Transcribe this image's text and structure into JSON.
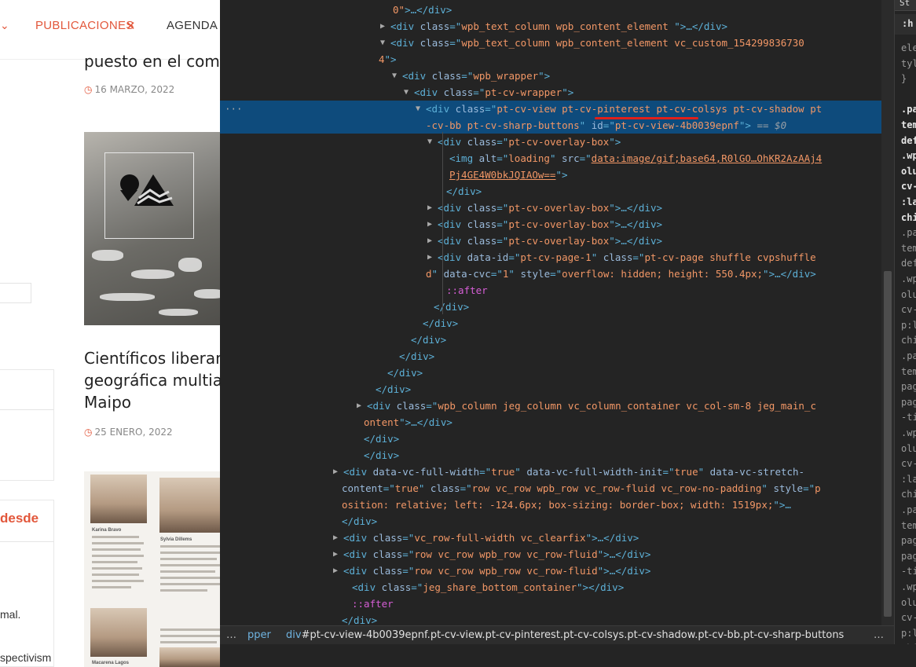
{
  "site": {
    "nav": {
      "left_chevron": "⌄",
      "publicaciones": "PUBLICACIONES",
      "publicaciones_close": "✕",
      "agenda": "AGENDA",
      "agenda_chevron": "⌄"
    },
    "article1": {
      "title": "puesto en el comit",
      "date": "16 MARZO, 2022"
    },
    "article2": {
      "title_lines": [
        "Científicos liberan",
        "geográfica multiar",
        "Maipo"
      ],
      "date": "25 ENERO, 2022"
    },
    "sidebar": {
      "red_text": "desde",
      "text_a": "mal.",
      "text_b": "spectivism"
    },
    "thumb2": {
      "name_a": "Karina Bravo",
      "name_b": "Sylvia Dillems",
      "name_c": "Macarena Lagos"
    },
    "icons": {
      "clock": "clock-icon"
    }
  },
  "devtools": {
    "dom_lines": [
      {
        "t": [
          [
            "val",
            "0\""
          ],
          [
            "tag",
            ">…</div>"
          ]
        ]
      },
      {
        "tri": "▶",
        "t": [
          [
            "tag",
            "<div "
          ],
          [
            "att",
            "class"
          ],
          [
            "tag",
            "=\""
          ],
          [
            "val",
            "wpb_text_column wpb_content_element "
          ],
          [
            "tag",
            "\">…</div>"
          ]
        ]
      },
      {
        "tri": "▼",
        "t": [
          [
            "tag",
            "<div "
          ],
          [
            "att",
            "class"
          ],
          [
            "tag",
            "=\""
          ],
          [
            "val",
            "wpb_text_column wpb_content_element  vc_custom_154299836730"
          ]
        ]
      },
      {
        "t": [
          [
            "val",
            "4"
          ],
          [
            "tag",
            "\">"
          ]
        ]
      },
      {
        "tri": "▼",
        "t": [
          [
            "tag",
            "<div "
          ],
          [
            "att",
            "class"
          ],
          [
            "tag",
            "=\""
          ],
          [
            "val",
            "wpb_wrapper"
          ],
          [
            "tag",
            "\">"
          ]
        ]
      },
      {
        "tri": "▼",
        "t": [
          [
            "tag",
            "<div "
          ],
          [
            "att",
            "class"
          ],
          [
            "tag",
            "=\""
          ],
          [
            "val",
            "pt-cv-wrapper"
          ],
          [
            "tag",
            "\">"
          ]
        ]
      },
      {
        "tri": "▼",
        "sel": true,
        "dots": "···",
        "t": [
          [
            "tag",
            "<div "
          ],
          [
            "att",
            "class"
          ],
          [
            "tag",
            "=\""
          ],
          [
            "val",
            "pt-cv-view pt-cv-pinterest pt-cv-colsys pt-cv-shadow pt"
          ]
        ]
      },
      {
        "sel": true,
        "t": [
          [
            "val",
            "-cv-bb pt-cv-sharp-buttons"
          ],
          [
            "tag",
            "\" "
          ],
          [
            "att",
            "id"
          ],
          [
            "tag",
            "=\""
          ],
          [
            "val",
            "pt-cv-view-4b0039epnf"
          ],
          [
            "tag",
            "\">"
          ],
          [
            "eq0",
            " == $0"
          ]
        ]
      },
      {
        "tri": "▼",
        "t": [
          [
            "tag",
            "<div "
          ],
          [
            "att",
            "class"
          ],
          [
            "tag",
            "=\""
          ],
          [
            "val",
            "pt-cv-overlay-box"
          ],
          [
            "tag",
            "\">"
          ]
        ]
      },
      {
        "t": [
          [
            "tag",
            "<img "
          ],
          [
            "att",
            "alt"
          ],
          [
            "tag",
            "=\""
          ],
          [
            "val",
            "loading"
          ],
          [
            "tag",
            "\" "
          ],
          [
            "att",
            "src"
          ],
          [
            "tag",
            "=\""
          ],
          [
            "link",
            "data:image/gif;base64,R0lGO…OhKR2AzAAj4"
          ]
        ]
      },
      {
        "t": [
          [
            "link",
            "Pj4GE4W0bkJQIAOw=="
          ],
          [
            "tag",
            "\">"
          ]
        ]
      },
      {
        "t": [
          [
            "tag",
            "</div>"
          ]
        ]
      },
      {
        "tri": "▶",
        "t": [
          [
            "tag",
            "<div "
          ],
          [
            "att",
            "class"
          ],
          [
            "tag",
            "=\""
          ],
          [
            "val",
            "pt-cv-overlay-box"
          ],
          [
            "tag",
            "\">…</div>"
          ]
        ]
      },
      {
        "tri": "▶",
        "t": [
          [
            "tag",
            "<div "
          ],
          [
            "att",
            "class"
          ],
          [
            "tag",
            "=\""
          ],
          [
            "val",
            "pt-cv-overlay-box"
          ],
          [
            "tag",
            "\">…</div>"
          ]
        ]
      },
      {
        "tri": "▶",
        "t": [
          [
            "tag",
            "<div "
          ],
          [
            "att",
            "class"
          ],
          [
            "tag",
            "=\""
          ],
          [
            "val",
            "pt-cv-overlay-box"
          ],
          [
            "tag",
            "\">…</div>"
          ]
        ]
      },
      {
        "tri": "▶",
        "t": [
          [
            "tag",
            "<div "
          ],
          [
            "att",
            "data-id"
          ],
          [
            "tag",
            "=\""
          ],
          [
            "val",
            "pt-cv-page-1"
          ],
          [
            "tag",
            "\" "
          ],
          [
            "att",
            "class"
          ],
          [
            "tag",
            "=\""
          ],
          [
            "val",
            "pt-cv-page shuffle cvpshuffle"
          ]
        ]
      },
      {
        "t": [
          [
            "val",
            "d"
          ],
          [
            "tag",
            "\" "
          ],
          [
            "att",
            "data-cvc"
          ],
          [
            "tag",
            "=\""
          ],
          [
            "val",
            "1"
          ],
          [
            "tag",
            "\" "
          ],
          [
            "att",
            "style"
          ],
          [
            "tag",
            "=\""
          ],
          [
            "val",
            "overflow: hidden; height: 550.4px;"
          ],
          [
            "tag",
            "\">…</div>"
          ]
        ]
      },
      {
        "t": [
          [
            "pseudo",
            "::after"
          ]
        ]
      },
      {
        "t": [
          [
            "tag",
            "</div>"
          ]
        ]
      },
      {
        "t": [
          [
            "tag",
            "</div>"
          ]
        ]
      },
      {
        "t": [
          [
            "tag",
            "</div>"
          ]
        ]
      },
      {
        "t": [
          [
            "tag",
            "</div>"
          ]
        ]
      },
      {
        "t": [
          [
            "tag",
            "</div>"
          ]
        ]
      },
      {
        "t": [
          [
            "tag",
            "</div>"
          ]
        ]
      },
      {
        "tri": "▶",
        "t": [
          [
            "tag",
            "<div "
          ],
          [
            "att",
            "class"
          ],
          [
            "tag",
            "=\""
          ],
          [
            "val",
            "wpb_column jeg_column vc_column_container vc_col-sm-8 jeg_main_c"
          ]
        ]
      },
      {
        "t": [
          [
            "val",
            "ontent"
          ],
          [
            "tag",
            "\">…</div>"
          ]
        ]
      },
      {
        "t": [
          [
            "tag",
            "</div>"
          ]
        ]
      },
      {
        "t": [
          [
            "tag",
            "</div>"
          ]
        ]
      },
      {
        "tri": "▶",
        "t": [
          [
            "tag",
            "<div "
          ],
          [
            "att",
            "data-vc-full-width"
          ],
          [
            "tag",
            "=\""
          ],
          [
            "val",
            "true"
          ],
          [
            "tag",
            "\" "
          ],
          [
            "att",
            "data-vc-full-width-init"
          ],
          [
            "tag",
            "=\""
          ],
          [
            "val",
            "true"
          ],
          [
            "tag",
            "\" "
          ],
          [
            "att",
            "data-vc-stretch-"
          ]
        ]
      },
      {
        "t": [
          [
            "att",
            "content"
          ],
          [
            "tag",
            "=\""
          ],
          [
            "val",
            "true"
          ],
          [
            "tag",
            "\" "
          ],
          [
            "att",
            "class"
          ],
          [
            "tag",
            "=\""
          ],
          [
            "val",
            "row vc_row wpb_row vc_row-fluid vc_row-no-padding"
          ],
          [
            "tag",
            "\" "
          ],
          [
            "att",
            "style"
          ],
          [
            "tag",
            "=\""
          ],
          [
            "val",
            "p"
          ]
        ]
      },
      {
        "t": [
          [
            "val",
            "osition: relative; left: -124.6px; box-sizing: border-box; width: 1519px;"
          ],
          [
            "tag",
            "\">…"
          ]
        ]
      },
      {
        "t": [
          [
            "tag",
            "</div>"
          ]
        ]
      },
      {
        "tri": "▶",
        "t": [
          [
            "tag",
            "<div "
          ],
          [
            "att",
            "class"
          ],
          [
            "tag",
            "=\""
          ],
          [
            "val",
            "vc_row-full-width vc_clearfix"
          ],
          [
            "tag",
            "\">…</div>"
          ]
        ]
      },
      {
        "tri": "▶",
        "t": [
          [
            "tag",
            "<div "
          ],
          [
            "att",
            "class"
          ],
          [
            "tag",
            "=\""
          ],
          [
            "val",
            "row vc_row wpb_row vc_row-fluid"
          ],
          [
            "tag",
            "\">…</div>"
          ]
        ]
      },
      {
        "tri": "▶",
        "t": [
          [
            "tag",
            "<div "
          ],
          [
            "att",
            "class"
          ],
          [
            "tag",
            "=\""
          ],
          [
            "val",
            "row vc_row wpb_row vc_row-fluid"
          ],
          [
            "tag",
            "\">…</div>"
          ]
        ]
      },
      {
        "t": [
          [
            "tag",
            "<div "
          ],
          [
            "att",
            "class"
          ],
          [
            "tag",
            "=\""
          ],
          [
            "val",
            "jeg_share_bottom_container"
          ],
          [
            "tag",
            "\"></div>"
          ]
        ]
      },
      {
        "t": [
          [
            "pseudo",
            "::after"
          ]
        ]
      },
      {
        "t": [
          [
            "tag",
            "</div>"
          ]
        ]
      }
    ],
    "breadcrumb": {
      "more": "…",
      "prev": "pper",
      "current_tag": "div",
      "current_rest": "#pt-cv-view-4b0039epnf.pt-cv-view.pt-cv-pinterest.pt-cv-colsys.pt-cv-shadow.pt-cv-bb.pt-cv-sharp-buttons",
      "more_right": "…"
    },
    "styles_pane": {
      "tab": "St",
      "filter": ":h",
      "lines": [
        {
          "c": "g",
          "t": "ele"
        },
        {
          "c": "g",
          "t": "tyl"
        },
        {
          "c": "g",
          "t": "}"
        },
        {
          "c": "g",
          "t": ""
        },
        {
          "c": "w",
          "t": ".pa"
        },
        {
          "c": "w",
          "t": "tem"
        },
        {
          "c": "w",
          "t": "def"
        },
        {
          "c": "w",
          "t": ".wp"
        },
        {
          "c": "w",
          "t": "olu"
        },
        {
          "c": "w",
          "t": "cv-"
        },
        {
          "c": "w",
          "t": ":la"
        },
        {
          "c": "w",
          "t": "chi"
        },
        {
          "c": "g",
          "t": ".pa"
        },
        {
          "c": "g",
          "t": "tem"
        },
        {
          "c": "g",
          "t": "def"
        },
        {
          "c": "g",
          "t": ".wp"
        },
        {
          "c": "g",
          "t": "olu"
        },
        {
          "c": "g",
          "t": "cv-"
        },
        {
          "c": "g",
          "t": "p:l"
        },
        {
          "c": "g",
          "t": "chi"
        },
        {
          "c": "g",
          "t": ".pa"
        },
        {
          "c": "g",
          "t": "tem"
        },
        {
          "c": "g",
          "t": "pag"
        },
        {
          "c": "g",
          "t": "pag"
        },
        {
          "c": "g",
          "t": "-ti"
        },
        {
          "c": "g",
          "t": ".wp"
        },
        {
          "c": "g",
          "t": "olu"
        },
        {
          "c": "g",
          "t": "cv-"
        },
        {
          "c": "g",
          "t": ":la"
        },
        {
          "c": "g",
          "t": "chi"
        },
        {
          "c": "g",
          "t": ".pa"
        },
        {
          "c": "g",
          "t": "tem"
        },
        {
          "c": "g",
          "t": "pag"
        },
        {
          "c": "g",
          "t": "pag"
        },
        {
          "c": "g",
          "t": "-ti"
        },
        {
          "c": "g",
          "t": ".wp"
        },
        {
          "c": "g",
          "t": "olu"
        },
        {
          "c": "g",
          "t": "cv-"
        },
        {
          "c": "g",
          "t": "p:l"
        },
        {
          "c": "g",
          "t": "chi"
        }
      ]
    }
  },
  "colors": {
    "accent": "#e2573b",
    "devtools_bg": "#242424",
    "selected_row": "#0e4b7c",
    "tag": "#5db0d7",
    "attr_name": "#9bbbdc",
    "attr_value": "#f29766",
    "pseudo": "#d65ed6",
    "annotation_red": "#e0201a"
  }
}
